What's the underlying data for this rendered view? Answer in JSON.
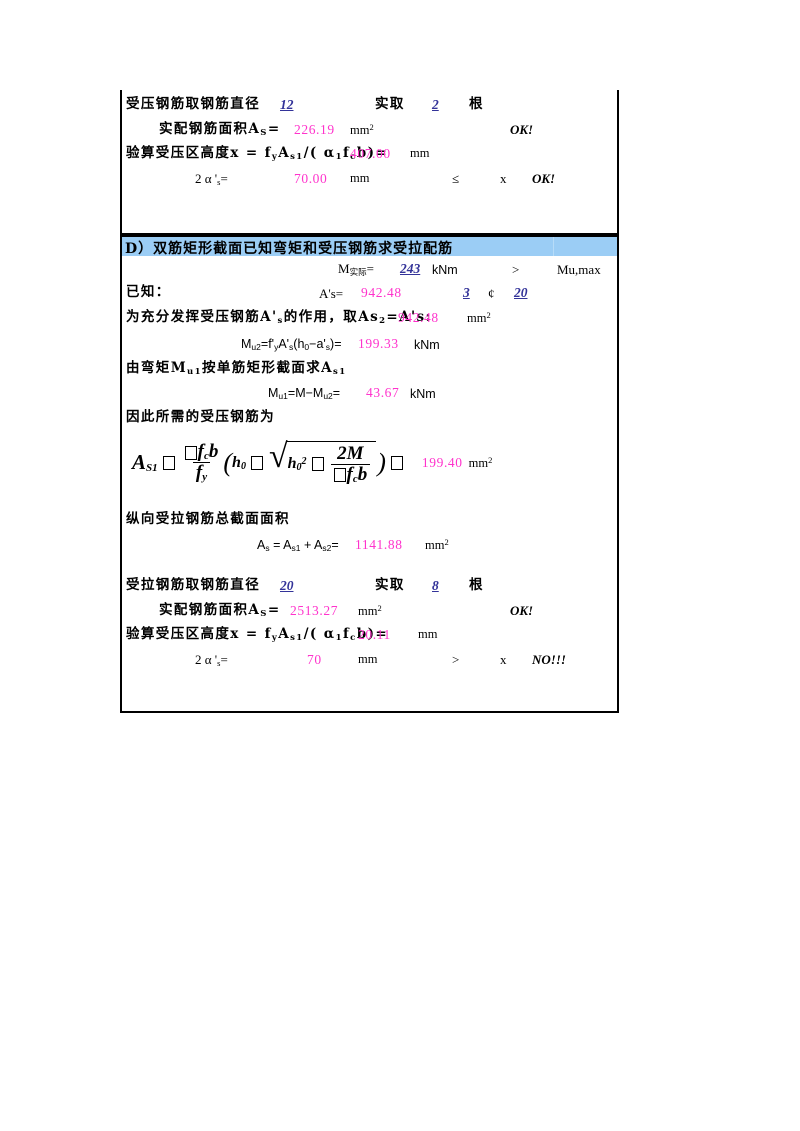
{
  "colors": {
    "input_blue": "#333399",
    "output_pink": "#ff33cc",
    "section_header_bg": "#9bcdf5",
    "border": "#000000",
    "page_bg": "#ffffff"
  },
  "block_top": {
    "row_diameter": {
      "label": "受压钢筋取钢筋直径",
      "diameter_value": "12",
      "actual_label": "实取",
      "count_value": "2",
      "count_unit": "根"
    },
    "row_area": {
      "label_prefix": "实配钢筋面积A",
      "label_sub": "S",
      "label_eq": "=",
      "value": "226.19",
      "unit": "mm",
      "unit_sup": "2",
      "status": "OK!"
    },
    "row_x": {
      "label": "验算受压区高度x = f",
      "label_sub1": "y",
      "label_mid": "A",
      "label_sub2": "s1",
      "label_mid2": "/( α",
      "label_sub3": "1",
      "label_mid3": "f",
      "label_sub4": "c",
      "label_end": "b)=",
      "value": "407.00",
      "unit": "mm"
    },
    "row_2as": {
      "label_pre": "2 α '",
      "label_sub": "s",
      "label_eq": "=",
      "value": "70.00",
      "unit": "mm",
      "operator": "≤",
      "compare_to": "x",
      "status": "OK!"
    }
  },
  "block_d": {
    "section_title": "D）双筋矩形截面已知弯矩和受压钢筋求受拉配筋",
    "row_m": {
      "label_pre": "M",
      "label_sub": "实际",
      "label_eq": "=",
      "value": "243",
      "unit": "kNm",
      "operator": ">",
      "compare_to": "Mu,max"
    },
    "row_known": {
      "label": "已知：",
      "as_label": "A's=",
      "as_value": "942.48",
      "bar_count": "3",
      "bar_symbol": "¢",
      "bar_diameter": "20"
    },
    "row_as2": {
      "text_pre": "为充分发挥受压钢筋A'",
      "text_sub": "s",
      "text_mid": "的作用，取As",
      "text_sub2": "2",
      "text_mid2": "=A's:",
      "value": "942.48",
      "unit": "mm",
      "unit_sup": "2"
    },
    "row_mu2": {
      "label_pre": "M",
      "label_sub": "u2",
      "label_mid": "=f'",
      "label_sub2": "y",
      "label_mid2": "A'",
      "label_sub3": "s",
      "label_mid3": "(h",
      "label_sub4": "0",
      "label_mid4": "−a'",
      "label_sub5": "s",
      "label_end": ")=",
      "value": "199.33",
      "unit": "kNm"
    },
    "row_note1": {
      "text_pre": "由弯矩M",
      "text_sub": "u1",
      "text_mid": "按单筋矩形截面求A",
      "text_sub2": "s1"
    },
    "row_mu1": {
      "label_pre": "M",
      "label_sub": "u1",
      "label_mid": "=M−M",
      "label_sub2": "u2",
      "label_end": "=",
      "value": "43.67",
      "unit": "kNm"
    },
    "row_note2": {
      "text": "因此所需的受压钢筋为"
    },
    "formula": {
      "lhs": "A",
      "lhs_sub": "S1",
      "missing_glyph": "□",
      "num_part": "f",
      "num_sub": "c",
      "num_b": "b",
      "den": "f",
      "den_sub": "y",
      "h0": "h",
      "h0_sub": "0",
      "h0sq_sub": "0",
      "h0sq_sup": "2",
      "frac2_num": "2M",
      "frac2_den_f": "f",
      "frac2_den_sub": "c",
      "frac2_den_b": "b",
      "result": "199.40",
      "unit": "mm",
      "unit_sup": "2"
    },
    "row_total_label": {
      "text": "纵向受拉钢筋总截面面积"
    },
    "row_total": {
      "label_pre": "A",
      "label_sub": "s",
      "label_mid": " = A",
      "label_sub2": "s1",
      "label_mid2": " + A",
      "label_sub3": "s2",
      "label_end": "=",
      "value": "1141.88",
      "unit": "mm",
      "unit_sup": "2"
    },
    "row_diameter": {
      "label": "受拉钢筋取钢筋直径",
      "diameter_value": "20",
      "actual_label": "实取",
      "count_value": "8",
      "count_unit": "根"
    },
    "row_area": {
      "label_prefix": "实配钢筋面积A",
      "label_sub": "S",
      "label_eq": "=",
      "value": "2513.27",
      "unit": "mm",
      "unit_sup": "2",
      "status": "OK!"
    },
    "row_x": {
      "label": "验算受压区高度x = f",
      "label_sub1": "y",
      "label_mid": "A",
      "label_sub2": "s1",
      "label_mid2": "/( α",
      "label_sub3": "1",
      "label_mid3": "f",
      "label_sub4": "c",
      "label_end": "b)=",
      "value": "20.11",
      "unit": "mm"
    },
    "row_2as": {
      "label_pre": "2 α '",
      "label_sub": "s",
      "label_eq": "=",
      "value": "70",
      "unit": "mm",
      "operator": ">",
      "compare_to": "x",
      "status": "NO!!!"
    }
  }
}
